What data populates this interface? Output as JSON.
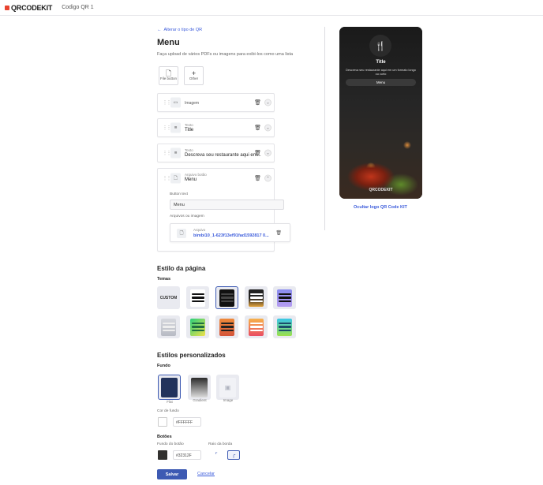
{
  "app": {
    "logo_text": "QRCODEKIT",
    "doc_title": "Codigo QR 1"
  },
  "nav": {
    "back_label": "Alterar o tipo de QR"
  },
  "editor": {
    "title": "Menu",
    "description": "Faça upload de vários PDFs ou imagens para exibi-los como uma lista",
    "add_buttons": [
      {
        "label": "File button",
        "icon": "file-icon"
      },
      {
        "label": "Other",
        "icon": "plus-icon"
      }
    ],
    "blocks": [
      {
        "small_label": "",
        "label": "Imagem",
        "icon": "image-icon"
      },
      {
        "small_label": "Texto",
        "label": "Title",
        "icon": "text-icon"
      },
      {
        "small_label": "Texto",
        "label": "Descreva seu restaurante aqui em...",
        "icon": "text-icon"
      },
      {
        "small_label": "Arquivo botão",
        "label": "Menu",
        "icon": "file-icon"
      }
    ],
    "expanded": {
      "button_text_label": "Button text",
      "button_text_value": "Menu",
      "files_label": "Arquivos ou imagem",
      "file_small_label": "Arquivo",
      "file_name": "bimbi10_1-623f13ef91fad1592817 0..."
    }
  },
  "page_style": {
    "title": "Estilo da página",
    "themes_label": "Temas",
    "custom_label": "CUSTOM",
    "selected_theme_index": 2
  },
  "custom_styles": {
    "title": "Estilos personalizados",
    "background_label": "Fundo",
    "bg_options": [
      {
        "label": "Flat"
      },
      {
        "label": "Gradient"
      },
      {
        "label": "Image"
      }
    ],
    "bg_color_label": "Cor de fundo",
    "bg_color_hex": "#FFFFFF",
    "buttons_label": "Botões",
    "button_bg_label": "Fundo do botão",
    "button_bg_hex": "#32312F",
    "border_radius_label": "Raio da borda"
  },
  "actions": {
    "save_label": "Salvar",
    "cancel_label": "Cancelar"
  },
  "preview": {
    "title": "Title",
    "description": "Descreva seu restaurante aqui em um formato longo ou curto",
    "button": "Menu",
    "watermark": "QRCODEKIT",
    "hide_logo_label": "Ocultar logo QR Code KIT"
  },
  "colors": {
    "accent": "#3d5ab3",
    "link": "#3b5bdb",
    "button_bg": "#32312F"
  }
}
